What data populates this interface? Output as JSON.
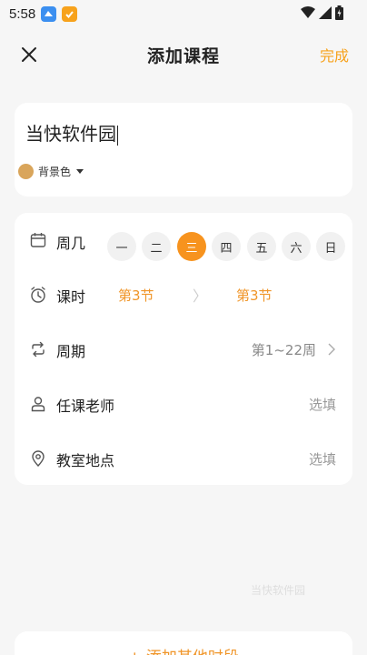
{
  "status_bar": {
    "time": "5:58"
  },
  "header": {
    "title": "添加课程",
    "done_label": "完成"
  },
  "course": {
    "name": "当快软件园",
    "bg_color_label": "背景色",
    "bg_color": "#d9a55b"
  },
  "weekday": {
    "label": "周几",
    "days": [
      "一",
      "二",
      "三",
      "四",
      "五",
      "六",
      "日"
    ],
    "selected": "三"
  },
  "period": {
    "label": "课时",
    "start": "第3节",
    "end": "第3节"
  },
  "cycle": {
    "label": "周期",
    "value": "第1~22周"
  },
  "teacher": {
    "label": "任课老师",
    "placeholder": "选填"
  },
  "classroom": {
    "label": "教室地点",
    "placeholder": "选填"
  },
  "watermark": "当快软件园",
  "bottom": {
    "add_other_label": "+ 添加其他时段"
  },
  "colors": {
    "accent": "#f7931e",
    "background": "#f6f6f6"
  }
}
